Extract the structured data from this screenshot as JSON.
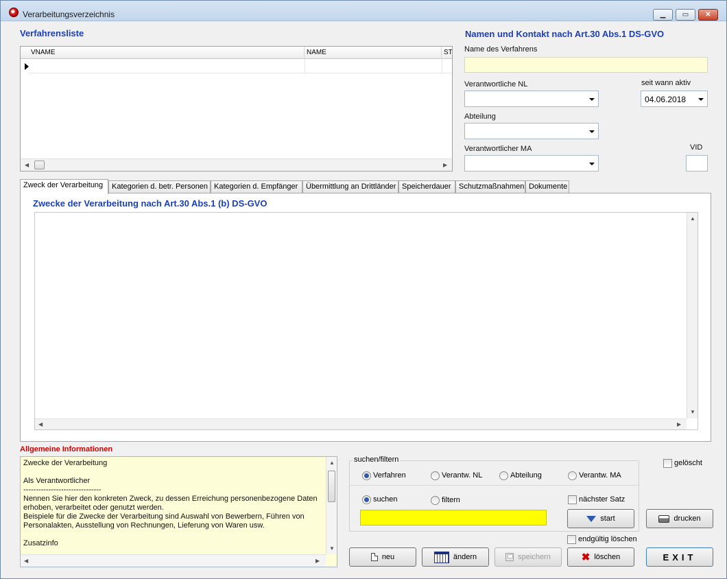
{
  "window": {
    "title": "Verarbeitungsverzeichnis",
    "min_glyph": "▁",
    "max_glyph": "▭",
    "close_glyph": "✕"
  },
  "list": {
    "heading": "Verfahrensliste",
    "columns": [
      "VNAME",
      "NAME",
      "ST"
    ]
  },
  "contact": {
    "heading": "Namen und Kontakt nach Art.30 Abs.1 DS-GVO",
    "name_label": "Name des Verfahrens",
    "name_value": "",
    "nl_label": "Verantwortliche NL",
    "nl_value": "",
    "since_label": "seit wann aktiv",
    "since_value": "04.06.2018",
    "dept_label": "Abteilung",
    "dept_value": "",
    "ma_label": "Verantwortlicher MA",
    "ma_value": "",
    "vid_label": "VID",
    "vid_value": ""
  },
  "tabs": [
    "Zweck der Verarbeitung",
    "Kategorien d. betr. Personen",
    "Kategorien d. Empfänger",
    "Übermittlung an Drittländer",
    "Speicherdauer",
    "Schutzmaßnahmen",
    "Dokumente"
  ],
  "tab_panel": {
    "heading": "Zwecke der Verarbeitung nach Art.30 Abs.1 (b) DS-GVO",
    "text": ""
  },
  "general_info": {
    "heading": "Allgemeine Informationen",
    "text": "Zwecke der Verarbeitung\n\nAls Verantwortlicher\n-------------------------------\nNennen Sie hier den konkreten Zweck, zu dessen Erreichung personenbezogene Daten erhoben, verarbeitet oder genutzt werden.\nBeispiele für die Zwecke der Verarbeitung sind Auswahl von Bewerbern, Führen von Personalakten, Ausstellung von Rechnungen, Lieferung von Waren usw.\n\nZusatzinfo"
  },
  "search": {
    "group_label": "suchen/filtern",
    "fields": [
      {
        "label": "Verfahren",
        "selected": true
      },
      {
        "label": "Verantw. NL",
        "selected": false
      },
      {
        "label": "Abteilung",
        "selected": false
      },
      {
        "label": "Verantw. MA",
        "selected": false
      }
    ],
    "mode_search": "suchen",
    "mode_filter": "filtern",
    "next_record": "nächster Satz",
    "query": "",
    "start_label": "start"
  },
  "deleted_label": "gelöscht",
  "delete_final_label": "endgültig löschen",
  "buttons": {
    "new": "neu",
    "edit": "ändern",
    "save": "speichern",
    "delete": "löschen",
    "print": "drucken",
    "exit": "EXIT"
  },
  "colors": {
    "heading_blue": "#1b3fb8",
    "heading_red": "#d40000",
    "info_background": "#fdfdd8",
    "search_field": "#ffff00"
  }
}
